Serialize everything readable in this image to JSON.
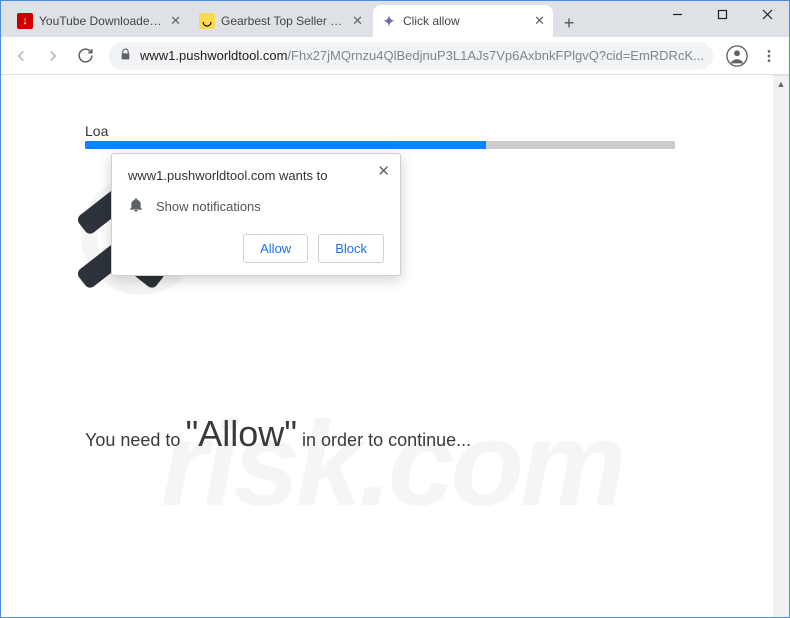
{
  "window": {
    "controls": {
      "min": "minimize",
      "max": "maximize",
      "close": "close"
    }
  },
  "tabs": [
    {
      "title": "YouTube Downloader - Do",
      "favicon": "yt",
      "active": false
    },
    {
      "title": "Gearbest Top Seller - Dive",
      "favicon": "gb",
      "active": false
    },
    {
      "title": "Click allow",
      "favicon": "ca",
      "active": true
    }
  ],
  "omnibox": {
    "domain": "www1.pushworldtool.com",
    "path": "/Fhx27jMQrnzu4QlBedjnuP3L1AJs7Vp6AxbnkFPlgvQ?cid=EmRDRcK..."
  },
  "page": {
    "loading_label": "Loa",
    "message_before": "You need to ",
    "message_emphasis": "\"Allow\"",
    "message_after": " in order to continue..."
  },
  "popup": {
    "origin": "www1.pushworldtool.com wants to",
    "permission_label": "Show notifications",
    "allow_label": "Allow",
    "block_label": "Block"
  },
  "watermark": {
    "line1": "PC",
    "line2": "risk.com"
  }
}
